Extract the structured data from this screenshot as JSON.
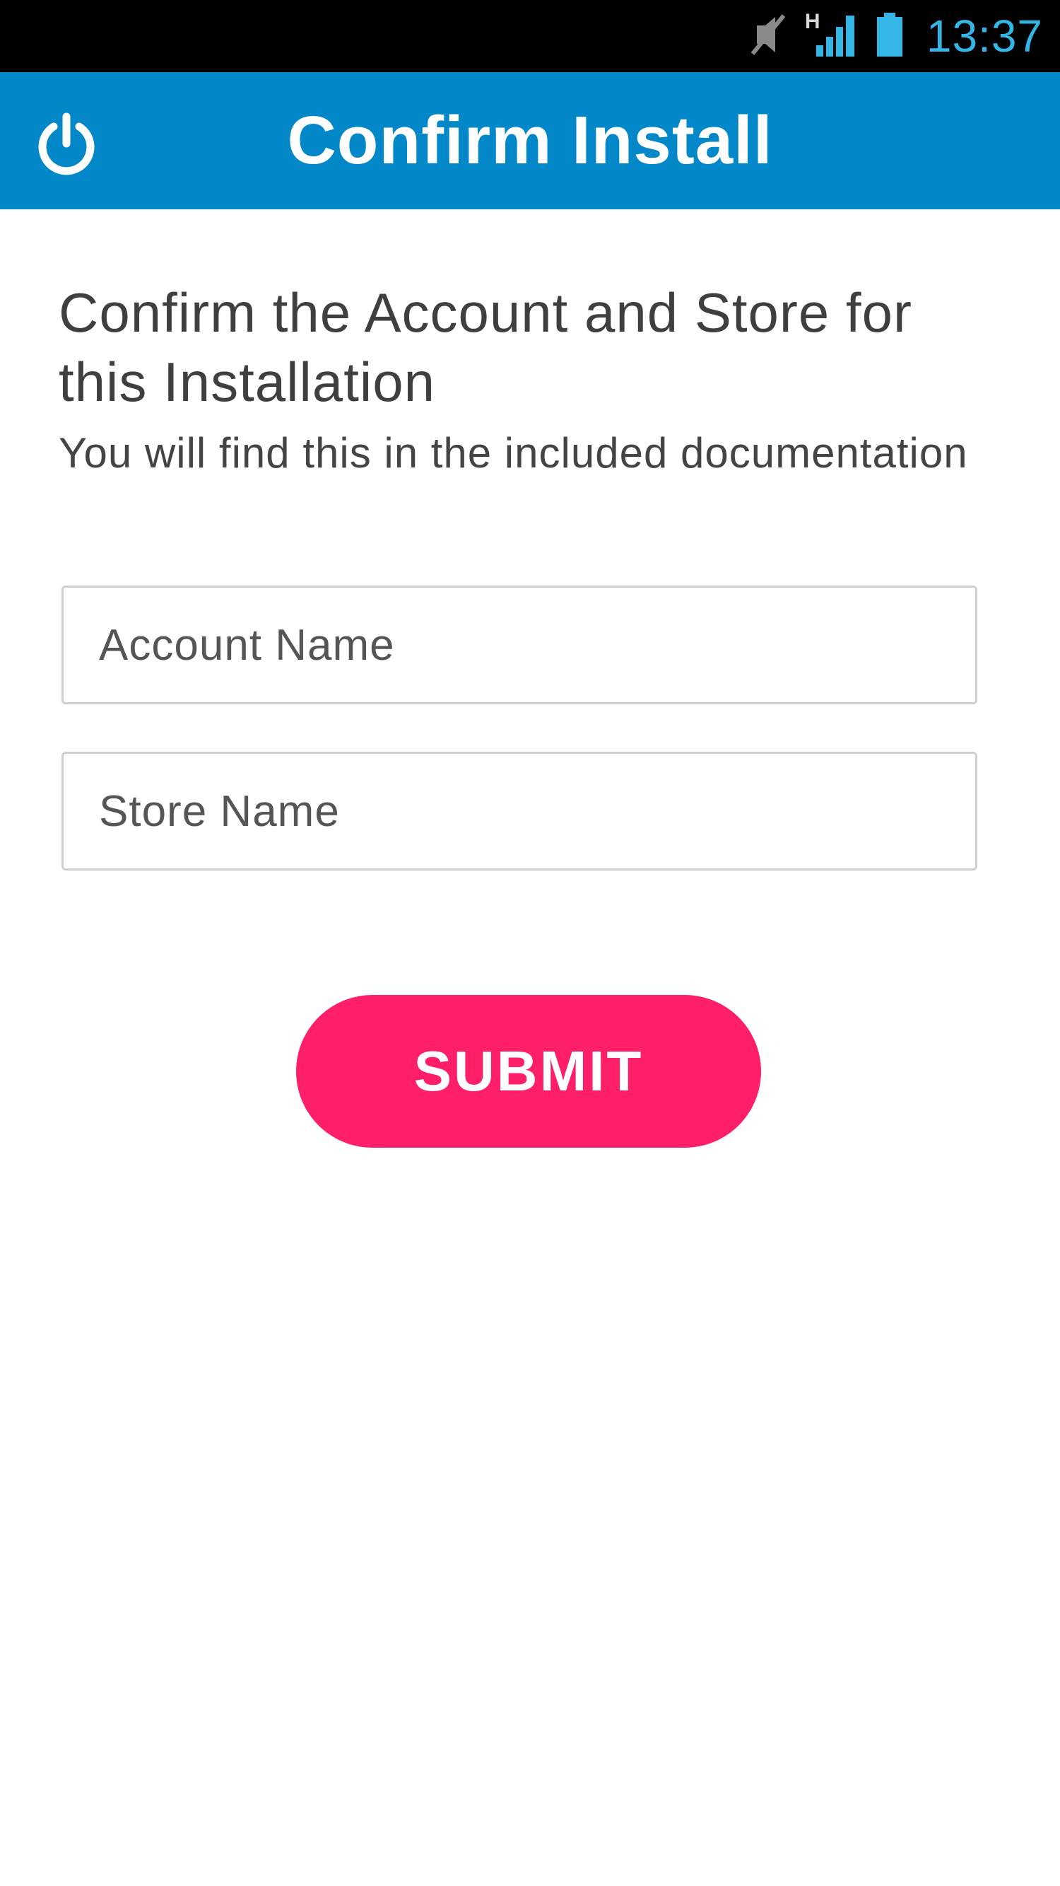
{
  "status_bar": {
    "time": "13:37",
    "network_type": "H",
    "icons": [
      "mute-icon",
      "signal-icon",
      "battery-icon"
    ],
    "time_color": "#33b5e5"
  },
  "app_bar": {
    "title": "Confirm Install",
    "left_icon": "power-icon",
    "background_color": "#0288c9"
  },
  "main": {
    "heading": "Confirm the Account and Store for this Installation",
    "subheading": "You will find this in the included documentation",
    "fields": {
      "account_name": {
        "placeholder": "Account Name",
        "value": ""
      },
      "store_name": {
        "placeholder": "Store Name",
        "value": ""
      }
    },
    "submit_label": "SUBMIT",
    "submit_color": "#ff1f68"
  }
}
